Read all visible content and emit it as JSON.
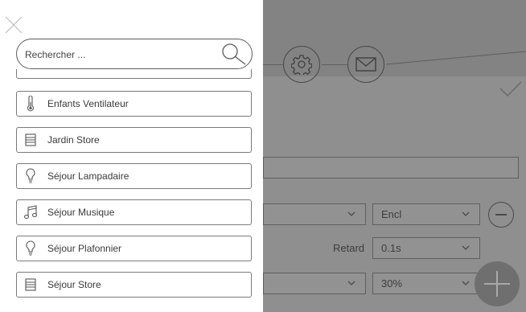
{
  "search": {
    "placeholder": "Rechercher ..."
  },
  "items": [
    {
      "label": "Enfants Ventilateur",
      "icon": "thermometer-icon"
    },
    {
      "label": "Jardin Store",
      "icon": "blinds-icon"
    },
    {
      "label": "Séjour Lampadaire",
      "icon": "lightbulb-icon"
    },
    {
      "label": "Séjour Musique",
      "icon": "music-note-icon"
    },
    {
      "label": "Séjour Plafonnier",
      "icon": "lightbulb-icon"
    },
    {
      "label": "Séjour Store",
      "icon": "blinds-icon"
    }
  ],
  "background": {
    "row1": {
      "select_value": "Encl"
    },
    "row2": {
      "retard_label": "Retard",
      "retard_value": "0.1s"
    },
    "row3": {
      "level_value": "30%"
    }
  }
}
